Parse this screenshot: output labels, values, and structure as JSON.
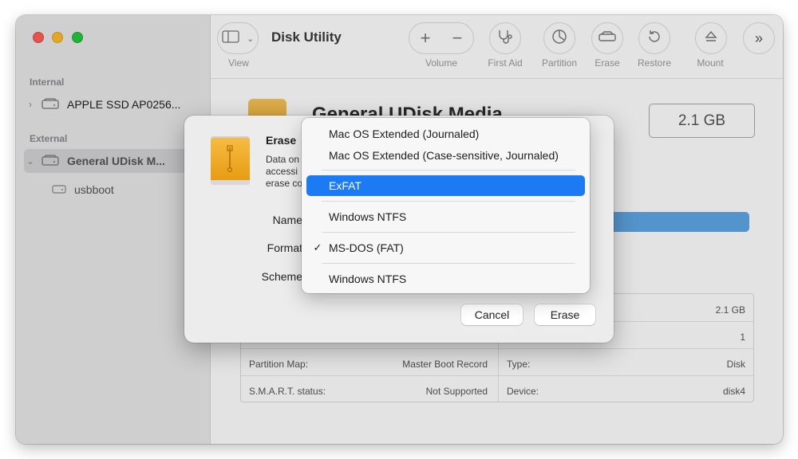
{
  "window": {
    "title": "Disk Utility"
  },
  "toolbar": {
    "view_label": "View",
    "volume_label": "Volume",
    "firstaid_label": "First Aid",
    "partition_label": "Partition",
    "erase_label": "Erase",
    "restore_label": "Restore",
    "mount_label": "Mount",
    "volume_add": "+",
    "volume_remove": "−"
  },
  "sidebar": {
    "internal_header": "Internal",
    "external_header": "External",
    "items": [
      {
        "label": "APPLE SSD AP0256..."
      },
      {
        "label": "General UDisk M..."
      },
      {
        "label": "usbboot"
      }
    ]
  },
  "main": {
    "disk_title": "General UDisk Media",
    "size": "2.1 GB",
    "info": [
      {
        "key": "",
        "value": "2.1 GB"
      },
      {
        "key": "",
        "value": "1"
      },
      {
        "key": "Partition Map:",
        "value": "Master Boot Record",
        "key2": "Type:",
        "value2": "Disk"
      },
      {
        "key": "S.M.A.R.T. status:",
        "value": "Not Supported",
        "key2": "Device:",
        "value2": "disk4"
      }
    ]
  },
  "dialog": {
    "title": "Erase",
    "text_line1": "Data on",
    "text_line2": "accessi",
    "text_line3": "erase co",
    "name_label": "Name",
    "format_label": "Format",
    "scheme_label": "Scheme",
    "cancel_label": "Cancel",
    "erase_label": "Erase"
  },
  "format_menu": {
    "items": [
      {
        "label": "Mac OS Extended (Journaled)",
        "checked": false
      },
      {
        "label": "Mac OS Extended (Case-sensitive, Journaled)",
        "checked": false
      },
      {
        "label": "ExFAT",
        "checked": false,
        "highlighted": true
      },
      {
        "label": "Windows NTFS",
        "checked": false
      },
      {
        "label": "MS-DOS (FAT)",
        "checked": true
      },
      {
        "label": "Windows NTFS",
        "checked": false
      }
    ],
    "check_mark": "✓"
  },
  "colors": {
    "accent": "#1c7af2",
    "usage_bar": "#5fa7e6"
  }
}
